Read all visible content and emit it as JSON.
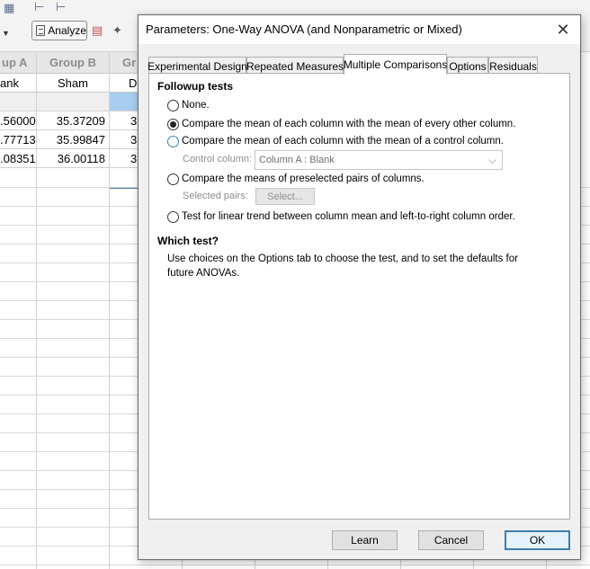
{
  "toolbar": {
    "analyze_label": "Analyze"
  },
  "sheet": {
    "columns": [
      {
        "header": "up A",
        "title": "ank"
      },
      {
        "header": "Group B",
        "title": "Sham"
      },
      {
        "header": "Gr",
        "title": "D"
      }
    ],
    "rows": [
      [
        ".56000",
        "35.37209",
        "3"
      ],
      [
        ".77713",
        "35.99847",
        "3"
      ],
      [
        ".08351",
        "36.00118",
        "3"
      ]
    ]
  },
  "dialog": {
    "title": "Parameters: One-Way ANOVA (and Nonparametric or Mixed)",
    "close_glyph": "✕",
    "tabs": [
      "Experimental Design",
      "Repeated Measures",
      "Multiple Comparisons",
      "Options",
      "Residuals"
    ],
    "active_tab": "Multiple Comparisons",
    "followup": {
      "title": "Followup tests",
      "options": [
        {
          "label": "None.",
          "checked": false
        },
        {
          "label": "Compare the mean of each column with the mean of every other column.",
          "checked": true
        },
        {
          "label": "Compare the mean of each column with the mean of a control column.",
          "checked": false
        },
        {
          "label": "Compare the means of preselected pairs of columns.",
          "checked": false
        },
        {
          "label": "Test for linear trend between column mean and left-to-right column order.",
          "checked": false
        }
      ],
      "control_column_label": "Control column:",
      "control_column_value": "Column A : Blank",
      "selected_pairs_label": "Selected pairs:",
      "select_button_label": "Select..."
    },
    "which_test": {
      "title": "Which test?",
      "description": "Use choices on the Options tab to choose the test, and to set the defaults for future ANOVAs."
    },
    "buttons": {
      "learn": "Learn",
      "cancel": "Cancel",
      "ok": "OK"
    }
  }
}
